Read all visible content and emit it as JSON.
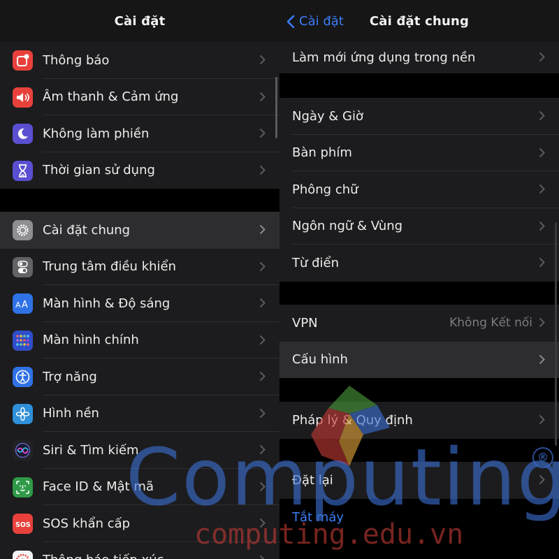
{
  "left": {
    "title": "Cài đặt",
    "groups": [
      [
        {
          "label": "Thông báo",
          "icon": "notifications-icon",
          "color": "#e8413c"
        },
        {
          "label": "Âm thanh & Cảm ứng",
          "icon": "sound-icon",
          "color": "#e8413c"
        },
        {
          "label": "Không làm phiền",
          "icon": "moon-icon",
          "color": "#5a4fd1"
        },
        {
          "label": "Thời gian sử dụng",
          "icon": "hourglass-icon",
          "color": "#5a4fd1"
        }
      ],
      [
        {
          "label": "Cài đặt chung",
          "icon": "gear-icon",
          "color": "#8e8e93"
        },
        {
          "label": "Trung tâm điều khiển",
          "icon": "toggle-icon",
          "color": "#636366"
        },
        {
          "label": "Màn hình & Độ sáng",
          "icon": "display-icon",
          "color": "#2f72e6"
        },
        {
          "label": "Màn hình chính",
          "icon": "home-grid-icon",
          "color": "#2f4ec9"
        },
        {
          "label": "Trợ năng",
          "icon": "accessibility-icon",
          "color": "#2f72e6"
        },
        {
          "label": "Hình nền",
          "icon": "flower-icon",
          "color": "#2f8fd8"
        },
        {
          "label": "Siri & Tìm kiếm",
          "icon": "siri-icon",
          "color": "#222226"
        },
        {
          "label": "Face ID & Mật mã",
          "icon": "face-id-icon",
          "color": "#2f9a48"
        },
        {
          "label": "SOS khẩn cấp",
          "icon": "sos-icon",
          "color": "#e8413c"
        },
        {
          "label": "Thông báo tiếp xúc",
          "icon": "exposure-icon",
          "color": "#f4f4f4"
        }
      ]
    ]
  },
  "right": {
    "back_label": "Cài đặt",
    "title": "Cài đặt chung",
    "groups": [
      [
        {
          "label": "Làm mới ứng dụng trong nền"
        }
      ],
      [
        {
          "label": "Ngày & Giờ"
        },
        {
          "label": "Bàn phím"
        },
        {
          "label": "Phông chữ"
        },
        {
          "label": "Ngôn ngữ & Vùng"
        },
        {
          "label": "Từ điển"
        }
      ],
      [
        {
          "label": "VPN",
          "detail": "Không Kết nối"
        },
        {
          "label": "Cấu hình"
        }
      ],
      [
        {
          "label": "Pháp lý & Quy định"
        }
      ],
      [
        {
          "label": "Đặt lại"
        }
      ]
    ],
    "shutdown_label": "Tắt máy"
  },
  "watermark": {
    "brand": "Computing",
    "site": "computing.edu.vn",
    "registered": "®"
  },
  "colors": {
    "accent": "#3d7df7",
    "background": "#000000",
    "cell": "#1c1c1e",
    "highlight": "#2d2d30"
  }
}
